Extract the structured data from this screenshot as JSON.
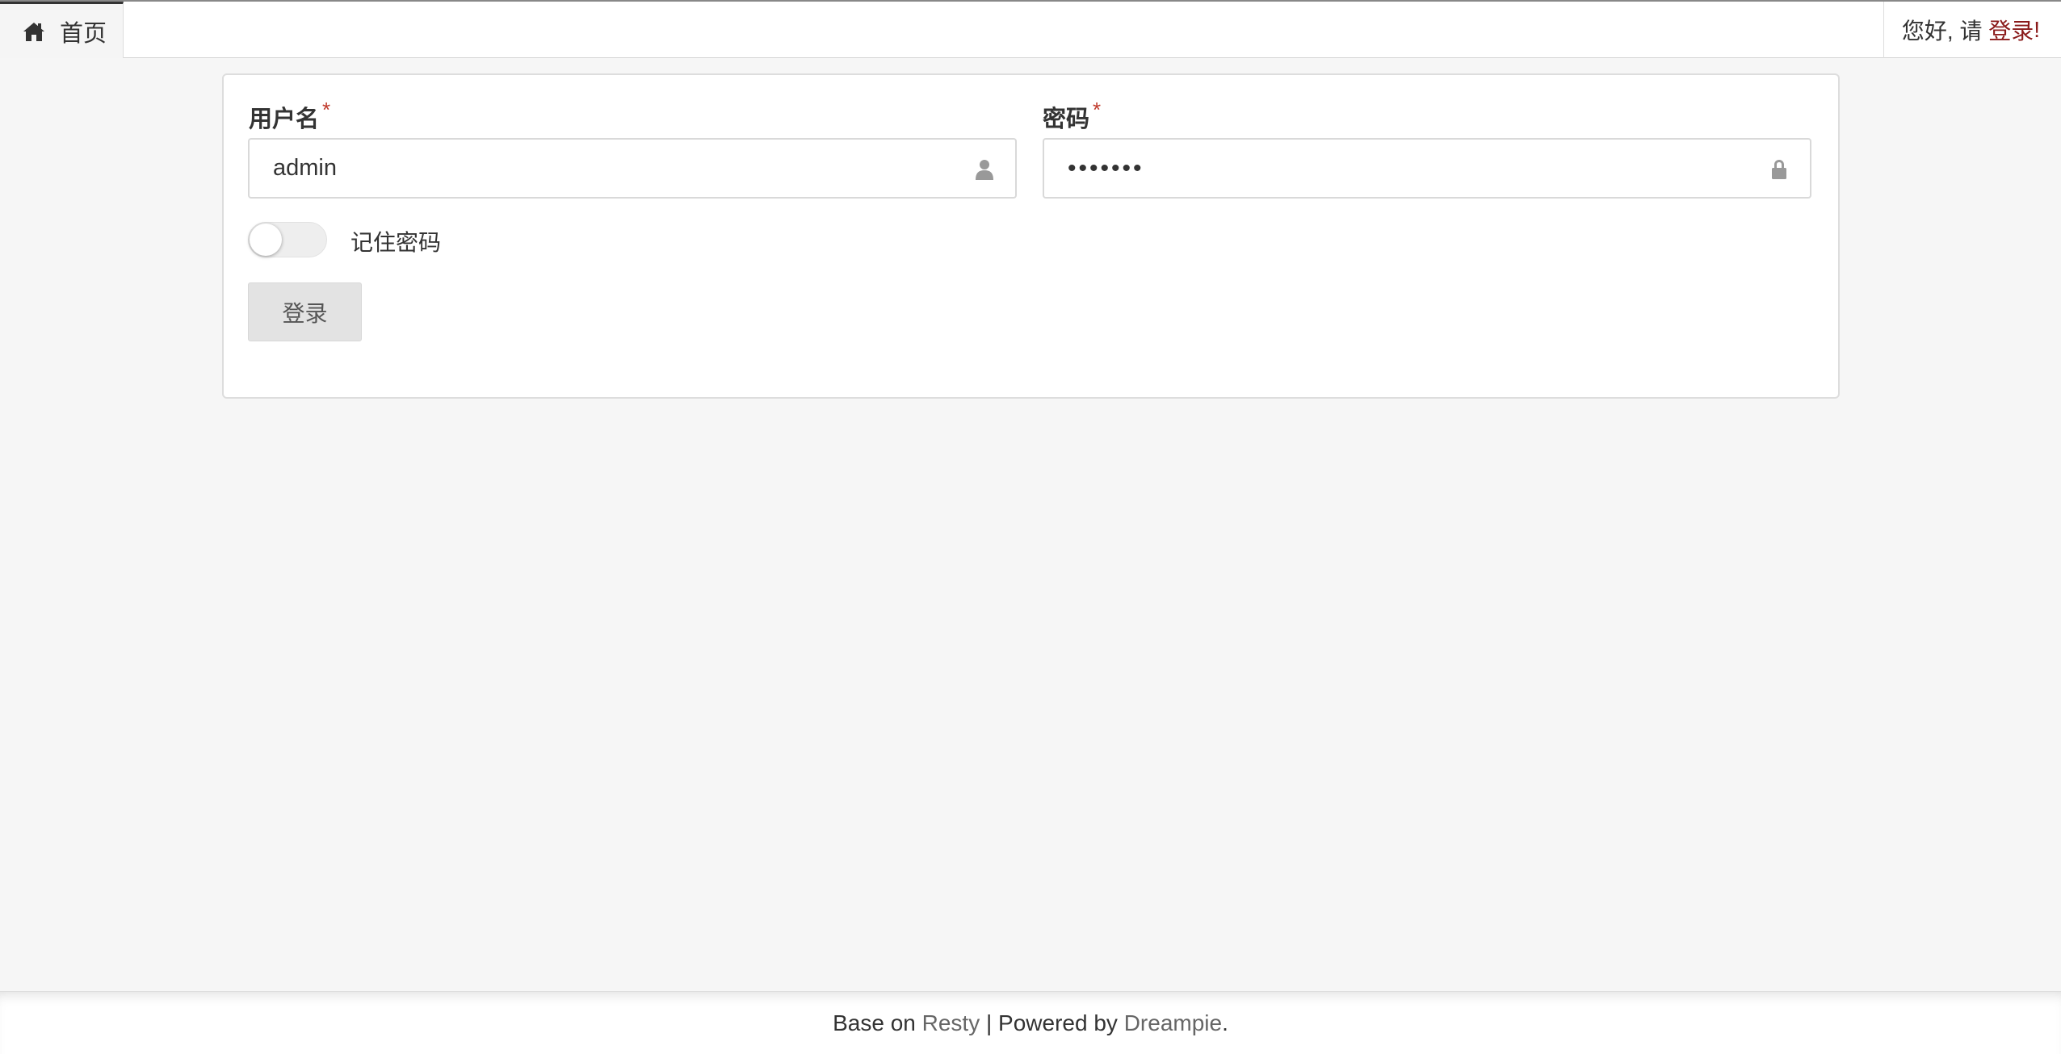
{
  "nav": {
    "home_icon": "home-icon",
    "home_label": "首页",
    "greeting_prefix": "您好, 请 ",
    "login_link": "登录",
    "greeting_suffix": "!"
  },
  "form": {
    "username": {
      "label": "用户名",
      "required_mark": "*",
      "value": "admin",
      "icon": "user-icon"
    },
    "password": {
      "label": "密码",
      "required_mark": "*",
      "value": "1234567",
      "icon": "lock-icon"
    },
    "remember": {
      "label": "记住密码",
      "checked": false
    },
    "submit_label": "登录"
  },
  "footer": {
    "prefix": "Base on ",
    "resty": "Resty",
    "middle": " | Powered by ",
    "dreampie": "Dreampie",
    "suffix": "."
  },
  "colors": {
    "required": "#c0392b",
    "login_link": "#8a1a1a",
    "background": "#f6f6f6"
  }
}
